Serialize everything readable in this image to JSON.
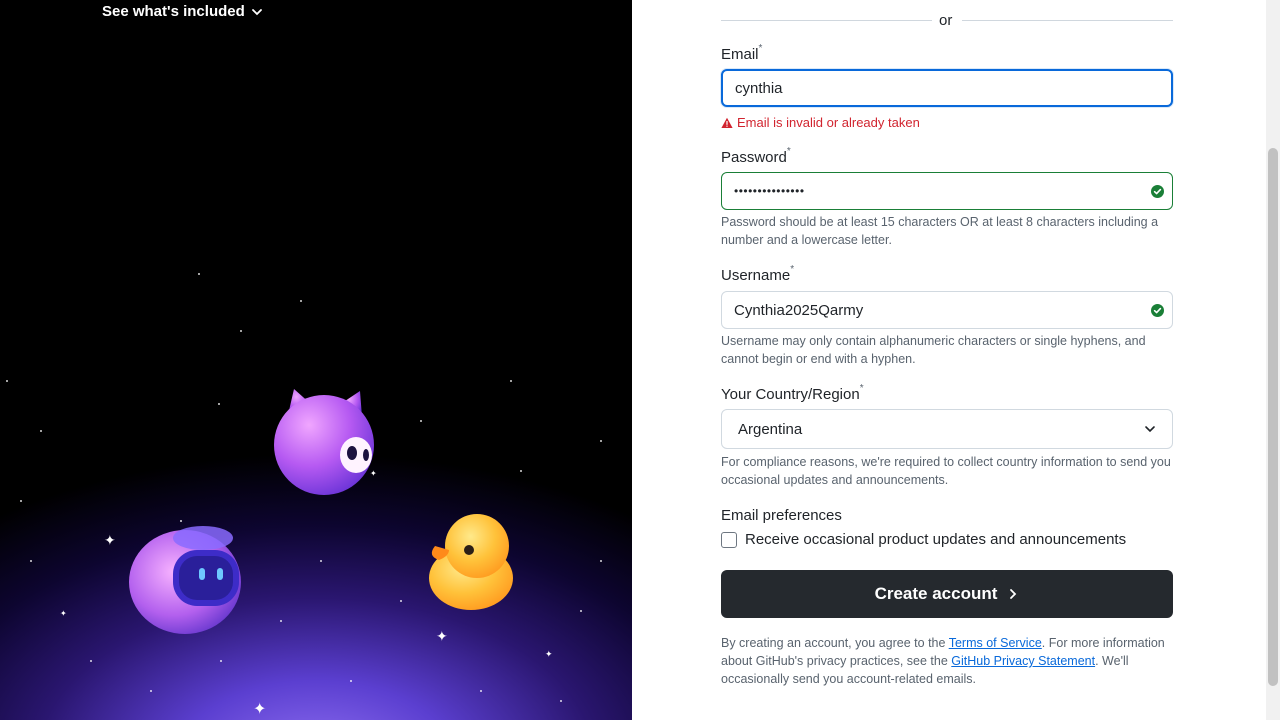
{
  "left_panel": {
    "included_label": "See what's included"
  },
  "form": {
    "divider_text": "or",
    "email": {
      "label": "Email",
      "required_mark": "*",
      "value": "cynthia",
      "error": "Email is invalid or already taken"
    },
    "password": {
      "label": "Password",
      "required_mark": "*",
      "value": "•••••••••••••••",
      "hint": "Password should be at least 15 characters OR at least 8 characters including a number and a lowercase letter."
    },
    "username": {
      "label": "Username",
      "required_mark": "*",
      "value": "Cynthia2025Qarmy",
      "hint": "Username may only contain alphanumeric characters or single hyphens, and cannot begin or end with a hyphen."
    },
    "country": {
      "label": "Your Country/Region",
      "required_mark": "*",
      "selected": "Argentina",
      "hint": "For compliance reasons, we're required to collect country information to send you occasional updates and announcements."
    },
    "email_preferences": {
      "title": "Email preferences",
      "checkbox_label": "Receive occasional product updates and announcements",
      "checked": false
    },
    "submit_label": "Create account",
    "legal": {
      "prefix": "By creating an account, you agree to the ",
      "terms_link": "Terms of Service",
      "middle": ". For more information about GitHub's privacy practices, see the ",
      "privacy_link": "GitHub Privacy Statement",
      "suffix": ". We'll occasionally send you account-related emails."
    }
  },
  "colors": {
    "focus_border": "#0969da",
    "error": "#d1242f",
    "valid": "#1a7f37",
    "button_bg": "#25292e"
  }
}
